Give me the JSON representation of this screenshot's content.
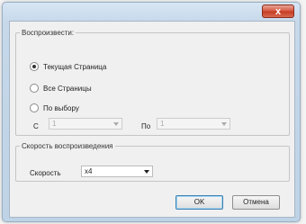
{
  "window": {
    "close_glyph": "x"
  },
  "playback_group": {
    "title": "Воспроизвести:",
    "options": [
      {
        "label": "Текущая Страница",
        "checked": true
      },
      {
        "label": "Все Страницы",
        "checked": false
      },
      {
        "label": "По выбору",
        "checked": false
      }
    ],
    "from_label": "С",
    "from_value": "1",
    "to_label": "По",
    "to_value": "1"
  },
  "speed_group": {
    "title": "Скорость воспроизведения",
    "speed_label": "Скорость",
    "speed_value": "x4"
  },
  "buttons": {
    "ok_label": "OK",
    "cancel_label": "Отмена"
  },
  "icons": {
    "radio": "radio-button",
    "dropdown": "chevron-down-icon",
    "close": "close-icon"
  }
}
